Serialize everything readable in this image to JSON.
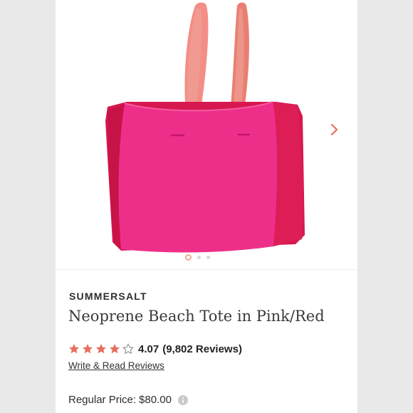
{
  "product": {
    "brand": "SUMMERSALT",
    "title": "Neoprene Beach Tote in Pink/Red",
    "rating": {
      "value": "4.07",
      "count": "(9,802 Reviews)",
      "stars": 4,
      "max_stars": 5
    },
    "reviews_link": "Write & Read Reviews",
    "price": {
      "label": "Regular Price:",
      "value": "$80.00"
    }
  },
  "gallery": {
    "image_count": 3,
    "active_index": 0,
    "next_icon": "chevron-right-icon"
  },
  "colors": {
    "accent": "#e8705e",
    "bag_pink": "#ee2f8a",
    "bag_red": "#d7174f",
    "star_empty": "#9a9a9a"
  }
}
